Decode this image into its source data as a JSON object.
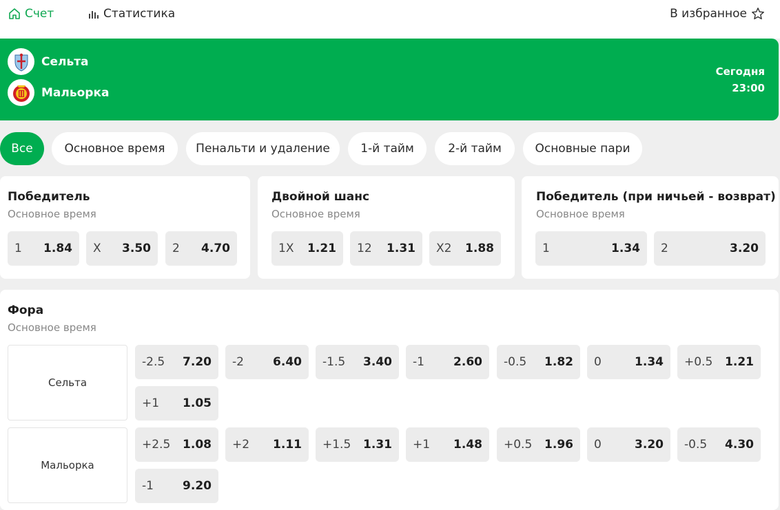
{
  "nav": {
    "score_label": "Счет",
    "stats_label": "Статистика",
    "favorite_label": "В избранное"
  },
  "match": {
    "home": "Сельта",
    "away": "Мальорка",
    "day": "Сегодня",
    "time": "23:00"
  },
  "filters": [
    "Все",
    "Основное время",
    "Пенальти и удаление",
    "1-й тайм",
    "2-й тайм",
    "Основные пари"
  ],
  "active_filter": "Все",
  "markets": {
    "winner": {
      "title": "Победитель",
      "subtitle": "Основное время",
      "odds": [
        {
          "label": "1",
          "value": "1.84"
        },
        {
          "label": "X",
          "value": "3.50"
        },
        {
          "label": "2",
          "value": "4.70"
        }
      ]
    },
    "double_chance": {
      "title": "Двойной шанс",
      "subtitle": "Основное время",
      "odds": [
        {
          "label": "1X",
          "value": "1.21"
        },
        {
          "label": "12",
          "value": "1.31"
        },
        {
          "label": "X2",
          "value": "1.88"
        }
      ]
    },
    "draw_no_bet": {
      "title": "Победитель (при ничьей - возврат)",
      "subtitle": "Основное время",
      "odds": [
        {
          "label": "1",
          "value": "1.34"
        },
        {
          "label": "2",
          "value": "3.20"
        }
      ]
    },
    "handicap": {
      "title": "Фора",
      "subtitle": "Основное время",
      "home_team": "Сельта",
      "away_team": "Мальорка",
      "home_odds": [
        {
          "label": "-2.5",
          "value": "7.20"
        },
        {
          "label": "-2",
          "value": "6.40"
        },
        {
          "label": "-1.5",
          "value": "3.40"
        },
        {
          "label": "-1",
          "value": "2.60"
        },
        {
          "label": "-0.5",
          "value": "1.82"
        },
        {
          "label": "0",
          "value": "1.34"
        },
        {
          "label": "+0.5",
          "value": "1.21"
        },
        {
          "label": "+1",
          "value": "1.05"
        }
      ],
      "away_odds": [
        {
          "label": "+2.5",
          "value": "1.08"
        },
        {
          "label": "+2",
          "value": "1.11"
        },
        {
          "label": "+1.5",
          "value": "1.31"
        },
        {
          "label": "+1",
          "value": "1.48"
        },
        {
          "label": "+0.5",
          "value": "1.96"
        },
        {
          "label": "0",
          "value": "3.20"
        },
        {
          "label": "-0.5",
          "value": "4.30"
        },
        {
          "label": "-1",
          "value": "9.20"
        }
      ]
    }
  },
  "colors": {
    "accent": "#00ad50",
    "odd_bg": "#ececec",
    "page_bg": "#efefef"
  },
  "icons": [
    "home-icon",
    "stats-icon",
    "star-icon",
    "celta-crest-icon",
    "mallorca-crest-icon"
  ]
}
